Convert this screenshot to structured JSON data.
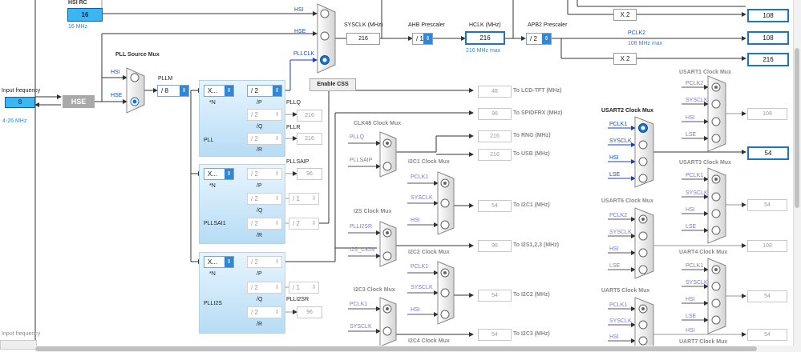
{
  "left": {
    "hsi_rc_label": "HSI RC",
    "hsi_rc_value": "16",
    "hsi_rc_freq": "16 MHz",
    "input_frequency_label": "Input frequency",
    "input_frequency_value": "8",
    "input_frequency_range": "4-26 MHz",
    "hse_label": "HSE",
    "input_frequency_label_2": "Input frequency"
  },
  "pll_source_mux": {
    "title": "PLL Source Mux",
    "hsi": "HSI",
    "hse": "HSE",
    "pllm_label": "PLLM",
    "pllm_value": "/ 8"
  },
  "system_mux": {
    "hsi": "HSI",
    "hse": "HSE",
    "pllclk": "PLLCLK",
    "enable_css": "Enable CSS"
  },
  "sysclk": {
    "label": "SYSCLK (MHz)",
    "value": "216",
    "ahb_label": "AHB Prescaler",
    "ahb_value": "/ 1",
    "hclk_label": "HCLK (MHz)",
    "hclk_value": "216",
    "hclk_max": "216 MHz max",
    "apb2_label": "APB2 Prescaler",
    "apb2_value": "/ 2",
    "x2_a": "X 2",
    "x2_b": "X 2",
    "pclk2_label": "PCLK2",
    "pclk2_max": "108 MHz max",
    "out1": "108",
    "out2": "108",
    "out3": "216"
  },
  "pll": {
    "n_value": "X...",
    "n_label": "*N",
    "p_value": "/ 2",
    "p_label": "/P",
    "q_value": "/ 2",
    "q_label": "/Q",
    "r_value": "/ 2",
    "r_label": "/R",
    "pllq_label": "PLLQ",
    "pllq_value": "216",
    "pllr_label": "PLLR",
    "pllr_value": "216",
    "name": "PLL"
  },
  "pllsai": {
    "n_value": "X...",
    "n_label": "*N",
    "p_value": "/ 2",
    "p_label": "/P",
    "q_value": "/ 2",
    "q_label": "/Q",
    "q_div": "/ 1",
    "r_value": "/ 2",
    "r_label": "/R",
    "r_div": "/ 2",
    "pllsaip_label": "PLLSAIP",
    "pllsaip_value": "96",
    "name": "PLLSAI1"
  },
  "plli2s": {
    "n_value": "X...",
    "n_label": "*N",
    "p_value": "/ 2",
    "p_label": "/P",
    "q_value": "/ 2",
    "q_label": "/Q",
    "q_div": "/ 1",
    "r_value": "/ 2",
    "r_label": "/R",
    "plli2sr_label": "PLLI2SR",
    "plli2sr_value": "96",
    "name": "PLLI2S"
  },
  "outputs": {
    "lcd_value": "48",
    "lcd_label": "To LCD-TFT (MHz)",
    "spdif_value": "96",
    "spdif_label": "To SPIDFRX (MHz)",
    "rng_value": "216",
    "rng_label": "To RNG (MHz)",
    "usb_value": "216",
    "usb_label": "To USB (MHz)",
    "i2c1_value": "54",
    "i2c1_label": "To I2C1 (MHz)",
    "i2s_value": "96",
    "i2s_label": "To I2S1,2,3 (MHz)",
    "i2c2_value": "54",
    "i2c2_label": "To I2C2 (MHz)",
    "i2c3_value": "54",
    "i2c3_label": "To I2C3 (MHz)"
  },
  "mid_muxes": {
    "clk48_title": "CLK48 Clock Mux",
    "clk48_in1": "PLLQ",
    "clk48_in2": "PLLSAIP",
    "i2c1_title": "I2C1 Clock Mux",
    "i2c1_in1": "PCLK1",
    "i2c1_in2": "SYSCLK",
    "i2c1_in3": "HSI",
    "i2s_title": "I2S Clock Mux",
    "i2s_in1": "PLLI2SR",
    "i2s_in2": "I2S_CKIN",
    "i2c2_title": "I2C2 Clock Mux",
    "i2c2_in1": "PCLK1",
    "i2c2_in2": "SYSCLK",
    "i2c2_in3": "HSI",
    "i2c3_title": "I2C3 Clock Mux",
    "i2c3_in1": "PCLK1",
    "i2c3_in2": "SYSCLK",
    "i2c4_title": "I2C4 Clock Mux"
  },
  "uart_muxes": {
    "usart1_title": "USART1 Clock Mux",
    "usart1_in": [
      "PCLK2",
      "SYSCLK",
      "HSI",
      "LSE"
    ],
    "usart1_value": "108",
    "usart2_title": "USART2 Clock Mux",
    "usart2_in": [
      "PCLK1",
      "SYSCLK",
      "HSI",
      "LSE"
    ],
    "usart2_value": "54",
    "usart3_title": "USART3 Clock Mux",
    "usart3_in": [
      "PCLK1",
      "SYSCLK",
      "HSI",
      "LSE"
    ],
    "usart3_value": "54",
    "usart6_title": "USART6 Clock Mux",
    "usart6_in": [
      "PCLK2",
      "SYSCLK",
      "HSI",
      "LSE"
    ],
    "usart6_value": "108",
    "uart4_title": "UART4 Clock Mux",
    "uart4_in": [
      "PCLK1",
      "SYSCLK",
      "HSI",
      "LSE"
    ],
    "uart4_value": "54",
    "uart5_title": "UART5 Clock Mux",
    "uart5_in": [
      "PCLK1",
      "SYSCLK",
      "HSI"
    ],
    "uart5_value": "54",
    "uart7_title": "UART7 Clock Mux",
    "uart7_in": [
      "HSI"
    ]
  },
  "colors": {
    "selected_blue": "#1c74c8",
    "input_blue": "#3ab7f0",
    "panel_light": "#e7f5ff",
    "panel_dark": "#b7dcf5",
    "wire": "#333333",
    "blue_wire": "#1a3fc0"
  }
}
